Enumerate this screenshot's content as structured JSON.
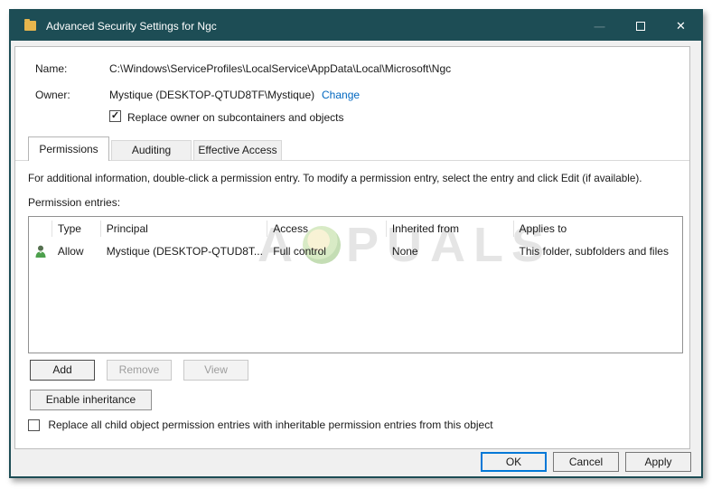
{
  "window": {
    "title": "Advanced Security Settings for Ngc",
    "controls": {
      "minimize": "—",
      "close": "✕"
    }
  },
  "fields": {
    "name_label": "Name:",
    "name_value": "C:\\Windows\\ServiceProfiles\\LocalService\\AppData\\Local\\Microsoft\\Ngc",
    "owner_label": "Owner:",
    "owner_value": "Mystique (DESKTOP-QTUD8TF\\Mystique)",
    "change_link": "Change",
    "replace_owner_label": "Replace owner on subcontainers and objects",
    "replace_owner_checked": true,
    "replace_owner_check_glyph": "✓"
  },
  "tabs": [
    {
      "label": "Permissions",
      "active": true
    },
    {
      "label": "Auditing",
      "active": false
    },
    {
      "label": "Effective Access",
      "active": false
    }
  ],
  "tab_content": {
    "info_text": "For additional information, double-click a permission entry. To modify a permission entry, select the entry and click Edit (if available).",
    "entries_label": "Permission entries:",
    "replace_child_label": "Replace all child object permission entries with inheritable permission entries from this object",
    "replace_child_checked": false,
    "replace_child_check_glyph": ""
  },
  "table": {
    "columns": [
      "Type",
      "Principal",
      "Access",
      "Inherited from",
      "Applies to"
    ],
    "rows": [
      {
        "icon": "user-icon",
        "type": "Allow",
        "principal": "Mystique (DESKTOP-QTUD8T...",
        "access": "Full control",
        "inherited_from": "None",
        "applies_to": "This folder, subfolders and files"
      }
    ]
  },
  "actions": {
    "add": "Add",
    "remove": "Remove",
    "view": "View",
    "enable_inheritance": "Enable inheritance"
  },
  "footer": {
    "ok": "OK",
    "cancel": "Cancel",
    "apply": "Apply"
  },
  "watermark": {
    "left": "A",
    "right": "PUALS"
  },
  "colors": {
    "titlebar": "#1d4d55",
    "link": "#0067c0",
    "default_button_border": "#0078d7",
    "watermark_text": "#e3e3e3",
    "user_icon_green": "#4da04d"
  }
}
